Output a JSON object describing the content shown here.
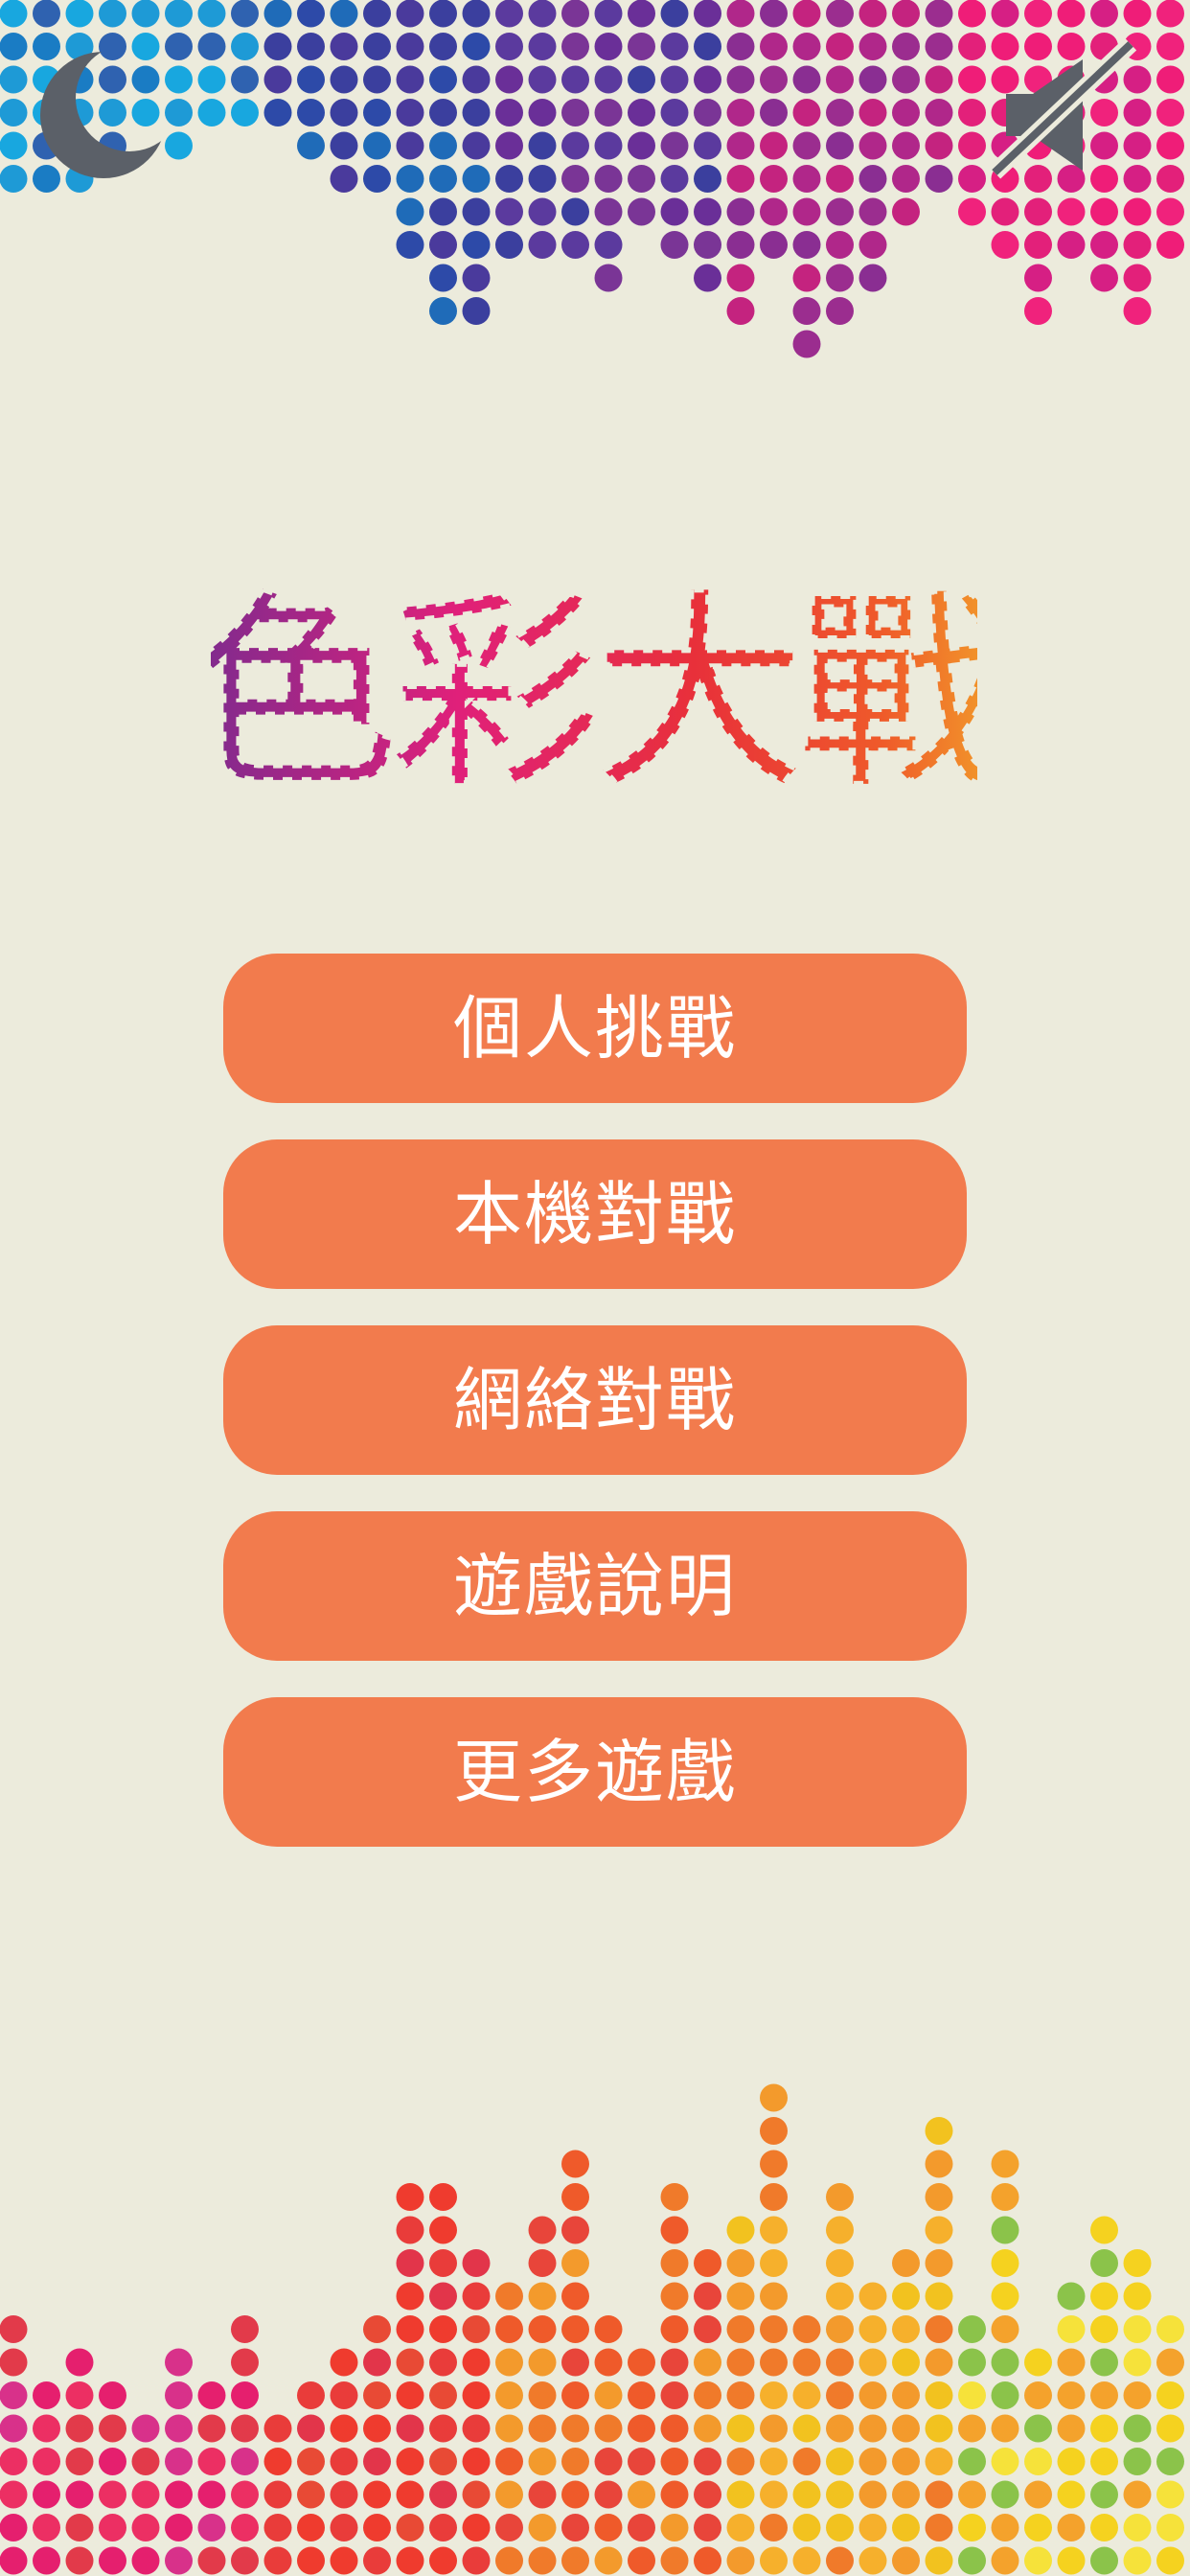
{
  "app": {
    "title": "色彩大戰"
  },
  "top_controls": {
    "night_mode_icon": "moon-icon",
    "sound_icon": "speaker-muted-icon"
  },
  "menu": {
    "items": [
      {
        "label": "個人挑戰"
      },
      {
        "label": "本機對戰"
      },
      {
        "label": "網絡對戰"
      },
      {
        "label": "遊戲說明"
      },
      {
        "label": "更多遊戲"
      }
    ]
  },
  "colors": {
    "background": "#ecebdc",
    "button": "#f27b4d",
    "button_text": "#ffffff",
    "icon": "#5b6068"
  }
}
